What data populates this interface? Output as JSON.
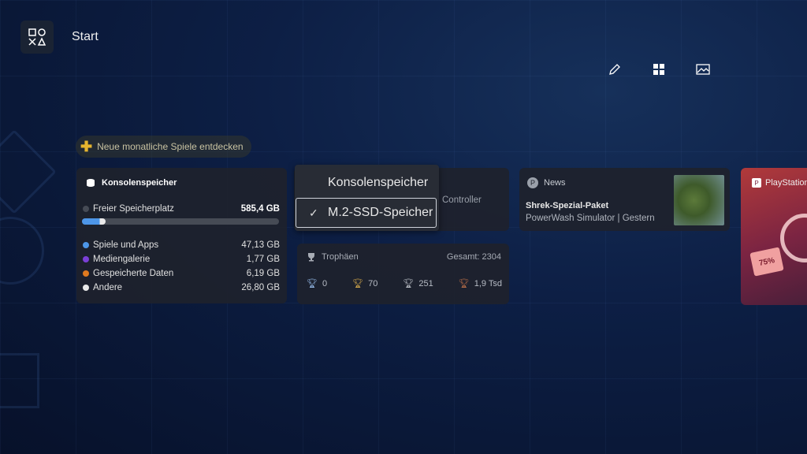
{
  "header": {
    "title": "Start",
    "home_icon": "playstation-shapes-icon"
  },
  "top_icons": [
    "pencil-icon",
    "grid-icon",
    "image-icon"
  ],
  "promo": {
    "label": "Neue monatliche Spiele entdecken",
    "icon": "ps-plus-icon"
  },
  "storage": {
    "title": "Konsolenspeicher",
    "free_label": "Freier Speicherplatz",
    "free_value": "585,4 GB",
    "used_fraction": 0.12,
    "items": [
      {
        "label": "Spiele und Apps",
        "value": "47,13 GB",
        "color": "#4d96e8"
      },
      {
        "label": "Mediengalerie",
        "value": "1,77 GB",
        "color": "#7a3fd6"
      },
      {
        "label": "Gespeicherte Daten",
        "value": "6,19 GB",
        "color": "#e07a1f"
      },
      {
        "label": "Andere",
        "value": "26,80 GB",
        "color": "#e9e9e9"
      }
    ]
  },
  "dropdown": {
    "options": [
      "Konsolenspeicher",
      "M.2-SSD-Speicher"
    ],
    "selected": "M.2-SSD-Speicher",
    "behind_text": "Controller"
  },
  "trophies": {
    "title": "Trophäen",
    "total": "Gesamt: 2304",
    "counts": [
      {
        "kind": "platinum",
        "value": "0",
        "color": "#8fb3e0"
      },
      {
        "kind": "gold",
        "value": "70",
        "color": "#caa14a"
      },
      {
        "kind": "silver",
        "value": "251",
        "color": "#b8bcc4"
      },
      {
        "kind": "bronze",
        "value": "1,9 Tsd",
        "color": "#b26b47"
      }
    ]
  },
  "news": {
    "title": "News",
    "headline": "Shrek-Spezial-Paket",
    "sub": "PowerWash Simulator | Gestern"
  },
  "playstation_card": {
    "title": "PlayStation",
    "badge": "75%"
  }
}
